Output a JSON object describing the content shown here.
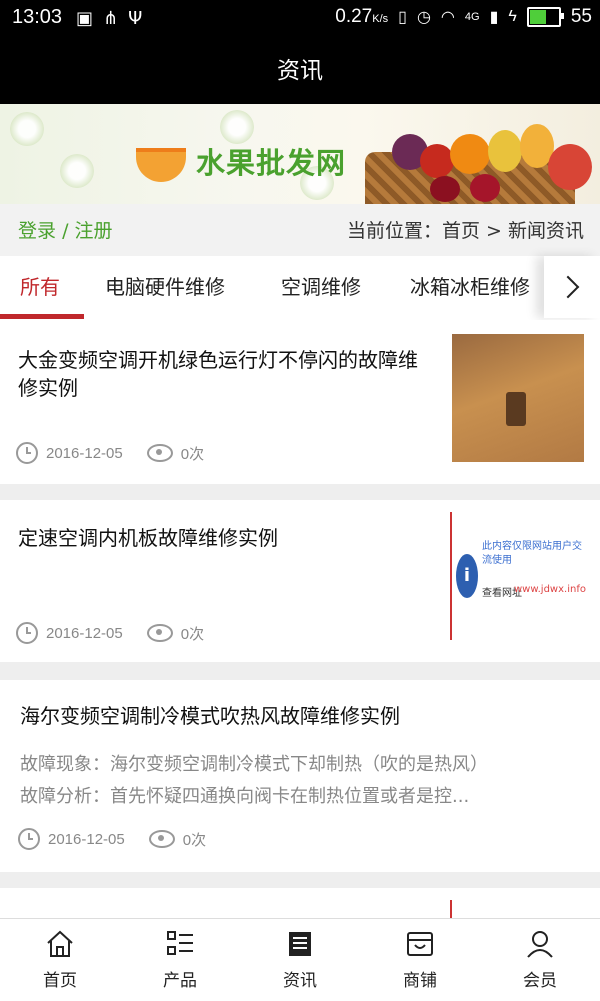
{
  "status_bar": {
    "time": "13:03",
    "speed": "0.27",
    "speed_unit": "K/s",
    "network": "4G",
    "battery": "55"
  },
  "header": {
    "title": "资讯"
  },
  "banner": {
    "logo_text": "水果批发网"
  },
  "location_bar": {
    "login": "登录",
    "divider": "/",
    "register": "注册",
    "breadcrumb": "当前位置：首页 > 新闻资讯"
  },
  "tabs": [
    "所有",
    "电脑硬件维修",
    "空调维修",
    "冰箱冰柜维修"
  ],
  "articles": [
    {
      "title": "大金变频空调开机绿色运行灯不停闪的故障维修实例",
      "date": "2016-12-05",
      "views": "0次"
    },
    {
      "title": "定速空调内机板故障维修实例",
      "date": "2016-12-05",
      "views": "0次",
      "thumb_text_1": "此内容仅限网站用户交流使用",
      "thumb_text_2": "查看网址",
      "thumb_text_3": "www.jdwx.info"
    },
    {
      "title": "海尔变频空调制冷模式吹热风故障维修实例",
      "summary_1": "故障现象：海尔变频空调制冷模式下却制热（吹的是热风）",
      "summary_2": "故障分析：首先怀疑四通换向阀卡在制热位置或者是控...",
      "date": "2016-12-05",
      "views": "0次"
    }
  ],
  "bottom_nav": [
    "首页",
    "产品",
    "资讯",
    "商铺",
    "会员"
  ],
  "colors": {
    "accent_red": "#c0282c",
    "brand_green": "#4aa12e"
  }
}
